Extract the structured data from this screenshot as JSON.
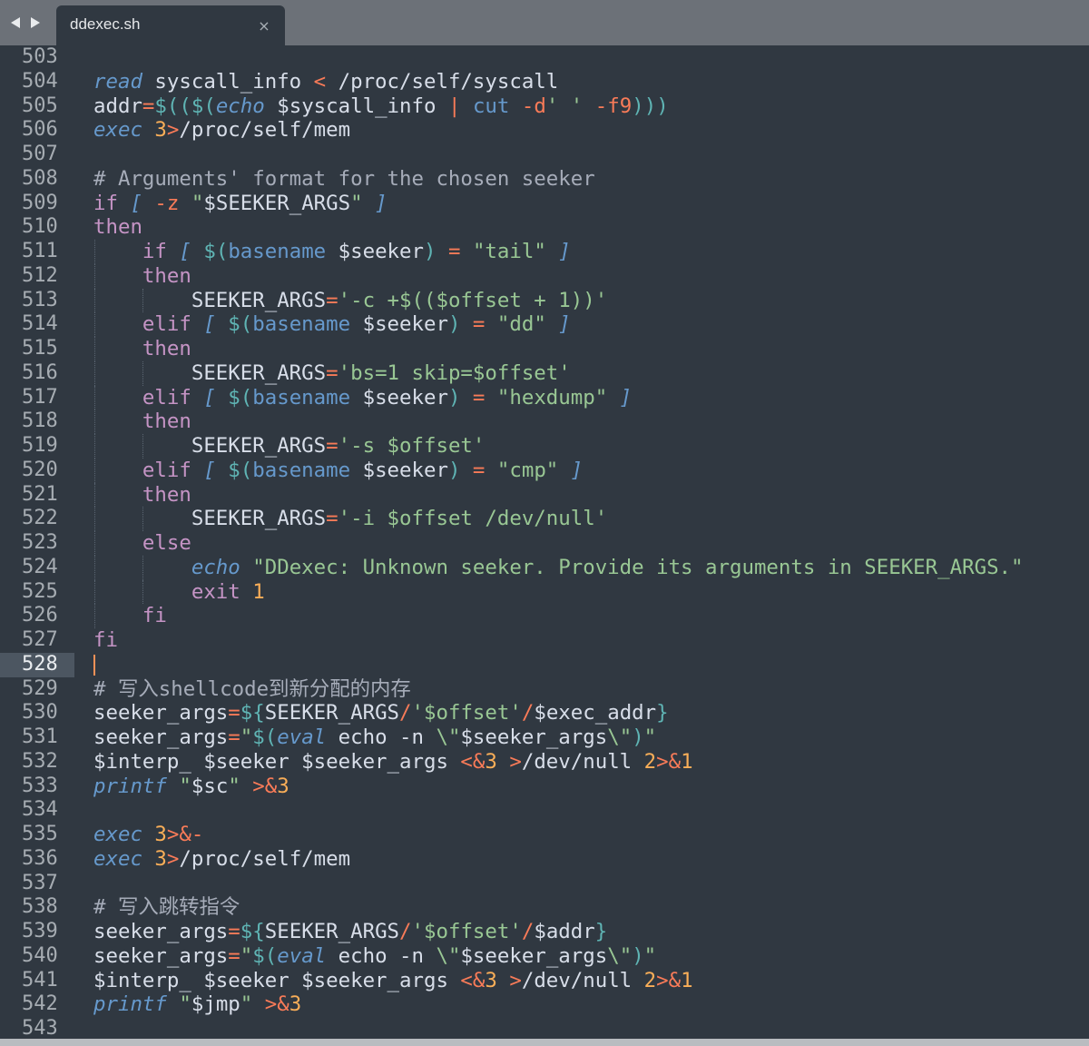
{
  "window": {
    "tab": {
      "title": "ddexec.sh",
      "close_glyph": "×"
    },
    "nav": [
      "back-arrow",
      "forward-arrow"
    ]
  },
  "editor": {
    "current_line": 528,
    "lines": [
      {
        "n": 503,
        "indent": 0,
        "tokens": []
      },
      {
        "n": 504,
        "indent": 0,
        "tokens": [
          [
            "bi",
            "read"
          ],
          [
            "var",
            " syscall_info "
          ],
          [
            "op",
            "<"
          ],
          [
            "var",
            " /proc/self/syscall"
          ]
        ]
      },
      {
        "n": 505,
        "indent": 0,
        "tokens": [
          [
            "var",
            "addr"
          ],
          [
            "op",
            "="
          ],
          [
            "pun",
            "$(("
          ],
          [
            "pun",
            "$("
          ],
          [
            "bi",
            "echo"
          ],
          [
            "var",
            " $syscall_info "
          ],
          [
            "op",
            "|"
          ],
          [
            "var",
            " "
          ],
          [
            "cmd",
            "cut"
          ],
          [
            "var",
            " "
          ],
          [
            "op",
            "-d"
          ],
          [
            "str",
            "' '"
          ],
          [
            "var",
            " "
          ],
          [
            "op",
            "-f9"
          ],
          [
            "pun",
            ")))"
          ]
        ]
      },
      {
        "n": 506,
        "indent": 0,
        "tokens": [
          [
            "bi",
            "exec"
          ],
          [
            "var",
            " "
          ],
          [
            "num",
            "3"
          ],
          [
            "op",
            ">"
          ],
          [
            "var",
            "/proc/self/mem"
          ]
        ]
      },
      {
        "n": 507,
        "indent": 0,
        "tokens": []
      },
      {
        "n": 508,
        "indent": 0,
        "tokens": [
          [
            "cmt",
            "# Arguments' format for the chosen seeker"
          ]
        ]
      },
      {
        "n": 509,
        "indent": 0,
        "tokens": [
          [
            "kw",
            "if"
          ],
          [
            "var",
            " "
          ],
          [
            "bi",
            "["
          ],
          [
            "var",
            " "
          ],
          [
            "op",
            "-z"
          ],
          [
            "var",
            " "
          ],
          [
            "str",
            "\""
          ],
          [
            "var",
            "$SEEKER_ARGS"
          ],
          [
            "str",
            "\""
          ],
          [
            "var",
            " "
          ],
          [
            "bi",
            "]"
          ]
        ]
      },
      {
        "n": 510,
        "indent": 0,
        "tokens": [
          [
            "kw",
            "then"
          ]
        ]
      },
      {
        "n": 511,
        "indent": 1,
        "tokens": [
          [
            "kw",
            "if"
          ],
          [
            "var",
            " "
          ],
          [
            "bi",
            "["
          ],
          [
            "var",
            " "
          ],
          [
            "pun",
            "$("
          ],
          [
            "cmd",
            "basename"
          ],
          [
            "var",
            " $seeker"
          ],
          [
            "pun",
            ")"
          ],
          [
            "var",
            " "
          ],
          [
            "op",
            "="
          ],
          [
            "var",
            " "
          ],
          [
            "str",
            "\"tail\""
          ],
          [
            "var",
            " "
          ],
          [
            "bi",
            "]"
          ]
        ]
      },
      {
        "n": 512,
        "indent": 1,
        "tokens": [
          [
            "kw",
            "then"
          ]
        ]
      },
      {
        "n": 513,
        "indent": 2,
        "tokens": [
          [
            "var",
            "SEEKER_ARGS"
          ],
          [
            "op",
            "="
          ],
          [
            "str",
            "'-c +$(($offset + 1))'"
          ]
        ]
      },
      {
        "n": 514,
        "indent": 1,
        "tokens": [
          [
            "kw",
            "elif"
          ],
          [
            "var",
            " "
          ],
          [
            "bi",
            "["
          ],
          [
            "var",
            " "
          ],
          [
            "pun",
            "$("
          ],
          [
            "cmd",
            "basename"
          ],
          [
            "var",
            " $seeker"
          ],
          [
            "pun",
            ")"
          ],
          [
            "var",
            " "
          ],
          [
            "op",
            "="
          ],
          [
            "var",
            " "
          ],
          [
            "str",
            "\"dd\""
          ],
          [
            "var",
            " "
          ],
          [
            "bi",
            "]"
          ]
        ]
      },
      {
        "n": 515,
        "indent": 1,
        "tokens": [
          [
            "kw",
            "then"
          ]
        ]
      },
      {
        "n": 516,
        "indent": 2,
        "tokens": [
          [
            "var",
            "SEEKER_ARGS"
          ],
          [
            "op",
            "="
          ],
          [
            "str",
            "'bs=1 skip=$offset'"
          ]
        ]
      },
      {
        "n": 517,
        "indent": 1,
        "tokens": [
          [
            "kw",
            "elif"
          ],
          [
            "var",
            " "
          ],
          [
            "bi",
            "["
          ],
          [
            "var",
            " "
          ],
          [
            "pun",
            "$("
          ],
          [
            "cmd",
            "basename"
          ],
          [
            "var",
            " $seeker"
          ],
          [
            "pun",
            ")"
          ],
          [
            "var",
            " "
          ],
          [
            "op",
            "="
          ],
          [
            "var",
            " "
          ],
          [
            "str",
            "\"hexdump\""
          ],
          [
            "var",
            " "
          ],
          [
            "bi",
            "]"
          ]
        ]
      },
      {
        "n": 518,
        "indent": 1,
        "tokens": [
          [
            "kw",
            "then"
          ]
        ]
      },
      {
        "n": 519,
        "indent": 2,
        "tokens": [
          [
            "var",
            "SEEKER_ARGS"
          ],
          [
            "op",
            "="
          ],
          [
            "str",
            "'-s $offset'"
          ]
        ]
      },
      {
        "n": 520,
        "indent": 1,
        "tokens": [
          [
            "kw",
            "elif"
          ],
          [
            "var",
            " "
          ],
          [
            "bi",
            "["
          ],
          [
            "var",
            " "
          ],
          [
            "pun",
            "$("
          ],
          [
            "cmd",
            "basename"
          ],
          [
            "var",
            " $seeker"
          ],
          [
            "pun",
            ")"
          ],
          [
            "var",
            " "
          ],
          [
            "op",
            "="
          ],
          [
            "var",
            " "
          ],
          [
            "str",
            "\"cmp\""
          ],
          [
            "var",
            " "
          ],
          [
            "bi",
            "]"
          ]
        ]
      },
      {
        "n": 521,
        "indent": 1,
        "tokens": [
          [
            "kw",
            "then"
          ]
        ]
      },
      {
        "n": 522,
        "indent": 2,
        "tokens": [
          [
            "var",
            "SEEKER_ARGS"
          ],
          [
            "op",
            "="
          ],
          [
            "str",
            "'-i $offset /dev/null'"
          ]
        ]
      },
      {
        "n": 523,
        "indent": 1,
        "tokens": [
          [
            "kw",
            "else"
          ]
        ]
      },
      {
        "n": 524,
        "indent": 2,
        "tokens": [
          [
            "bi",
            "echo"
          ],
          [
            "var",
            " "
          ],
          [
            "str",
            "\"DDexec: Unknown seeker. Provide its arguments in SEEKER_ARGS.\""
          ]
        ]
      },
      {
        "n": 525,
        "indent": 2,
        "tokens": [
          [
            "kw",
            "exit"
          ],
          [
            "var",
            " "
          ],
          [
            "num",
            "1"
          ]
        ]
      },
      {
        "n": 526,
        "indent": 1,
        "tokens": [
          [
            "kw",
            "fi"
          ]
        ]
      },
      {
        "n": 527,
        "indent": 0,
        "tokens": [
          [
            "kw",
            "fi"
          ]
        ]
      },
      {
        "n": 528,
        "indent": 0,
        "tokens": []
      },
      {
        "n": 529,
        "indent": 0,
        "tokens": [
          [
            "cmt",
            "# 写入shellcode到新分配的内存"
          ]
        ]
      },
      {
        "n": 530,
        "indent": 0,
        "tokens": [
          [
            "var",
            "seeker_args"
          ],
          [
            "op",
            "="
          ],
          [
            "pun",
            "${"
          ],
          [
            "var",
            "SEEKER_ARGS"
          ],
          [
            "op",
            "/"
          ],
          [
            "str",
            "'$offset'"
          ],
          [
            "op",
            "/"
          ],
          [
            "var",
            "$exec_addr"
          ],
          [
            "pun",
            "}"
          ]
        ]
      },
      {
        "n": 531,
        "indent": 0,
        "tokens": [
          [
            "var",
            "seeker_args"
          ],
          [
            "op",
            "="
          ],
          [
            "str",
            "\""
          ],
          [
            "pun",
            "$("
          ],
          [
            "bi",
            "eval"
          ],
          [
            "var",
            " echo -n "
          ],
          [
            "str",
            "\\\""
          ],
          [
            "var",
            "$seeker_args"
          ],
          [
            "str",
            "\\\""
          ],
          [
            "pun",
            ")"
          ],
          [
            "str",
            "\""
          ]
        ]
      },
      {
        "n": 532,
        "indent": 0,
        "tokens": [
          [
            "var",
            "$interp_ $seeker $seeker_args "
          ],
          [
            "op",
            "<&"
          ],
          [
            "num",
            "3"
          ],
          [
            "var",
            " "
          ],
          [
            "op",
            ">"
          ],
          [
            "var",
            "/dev/null "
          ],
          [
            "num",
            "2"
          ],
          [
            "op",
            ">&"
          ],
          [
            "num",
            "1"
          ]
        ]
      },
      {
        "n": 533,
        "indent": 0,
        "tokens": [
          [
            "bi",
            "printf"
          ],
          [
            "var",
            " "
          ],
          [
            "str",
            "\""
          ],
          [
            "var",
            "$sc"
          ],
          [
            "str",
            "\""
          ],
          [
            "var",
            " "
          ],
          [
            "op",
            ">&"
          ],
          [
            "num",
            "3"
          ]
        ]
      },
      {
        "n": 534,
        "indent": 0,
        "tokens": []
      },
      {
        "n": 535,
        "indent": 0,
        "tokens": [
          [
            "bi",
            "exec"
          ],
          [
            "var",
            " "
          ],
          [
            "num",
            "3"
          ],
          [
            "op",
            ">&-"
          ]
        ]
      },
      {
        "n": 536,
        "indent": 0,
        "tokens": [
          [
            "bi",
            "exec"
          ],
          [
            "var",
            " "
          ],
          [
            "num",
            "3"
          ],
          [
            "op",
            ">"
          ],
          [
            "var",
            "/proc/self/mem"
          ]
        ]
      },
      {
        "n": 537,
        "indent": 0,
        "tokens": []
      },
      {
        "n": 538,
        "indent": 0,
        "tokens": [
          [
            "cmt",
            "# 写入跳转指令"
          ]
        ]
      },
      {
        "n": 539,
        "indent": 0,
        "tokens": [
          [
            "var",
            "seeker_args"
          ],
          [
            "op",
            "="
          ],
          [
            "pun",
            "${"
          ],
          [
            "var",
            "SEEKER_ARGS"
          ],
          [
            "op",
            "/"
          ],
          [
            "str",
            "'$offset'"
          ],
          [
            "op",
            "/"
          ],
          [
            "var",
            "$addr"
          ],
          [
            "pun",
            "}"
          ]
        ]
      },
      {
        "n": 540,
        "indent": 0,
        "tokens": [
          [
            "var",
            "seeker_args"
          ],
          [
            "op",
            "="
          ],
          [
            "str",
            "\""
          ],
          [
            "pun",
            "$("
          ],
          [
            "bi",
            "eval"
          ],
          [
            "var",
            " echo -n "
          ],
          [
            "str",
            "\\\""
          ],
          [
            "var",
            "$seeker_args"
          ],
          [
            "str",
            "\\\""
          ],
          [
            "pun",
            ")"
          ],
          [
            "str",
            "\""
          ]
        ]
      },
      {
        "n": 541,
        "indent": 0,
        "tokens": [
          [
            "var",
            "$interp_ $seeker $seeker_args "
          ],
          [
            "op",
            "<&"
          ],
          [
            "num",
            "3"
          ],
          [
            "var",
            " "
          ],
          [
            "op",
            ">"
          ],
          [
            "var",
            "/dev/null "
          ],
          [
            "num",
            "2"
          ],
          [
            "op",
            ">&"
          ],
          [
            "num",
            "1"
          ]
        ]
      },
      {
        "n": 542,
        "indent": 0,
        "tokens": [
          [
            "bi",
            "printf"
          ],
          [
            "var",
            " "
          ],
          [
            "str",
            "\""
          ],
          [
            "var",
            "$jmp"
          ],
          [
            "str",
            "\""
          ],
          [
            "var",
            " "
          ],
          [
            "op",
            ">&"
          ],
          [
            "num",
            "3"
          ]
        ]
      },
      {
        "n": 543,
        "indent": 0,
        "tokens": []
      }
    ]
  },
  "colors": {
    "background": "#303841",
    "tabbar": "#6c7178",
    "keyword": "#c594c5",
    "builtin": "#6699cc",
    "operator": "#f97b58",
    "number": "#f9ae58",
    "string": "#99c794",
    "comment": "#a6acb9",
    "cursor": "#f99157"
  }
}
